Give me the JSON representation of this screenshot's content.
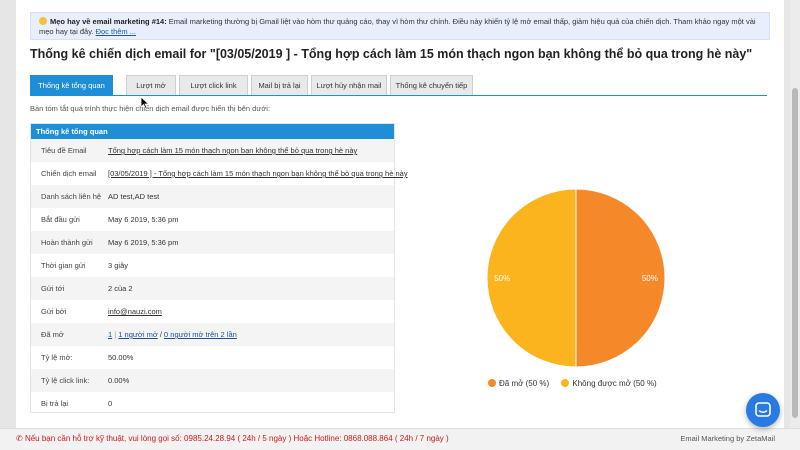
{
  "tip": {
    "label": "Mẹo hay về email marketing #14:",
    "text": " Email marketing thường bị Gmail liệt vào hòm thư quảng cáo, thay vì hòm thư chính. Điều này khiến tỷ lệ mở email thấp, giảm hiệu quả của chiến dịch. Tham khảo ngay một vài mẹo hay tại đây. ",
    "link": "Đọc thêm ..."
  },
  "page_title": "Thống kê chiến dịch email for \"[03/05/2019 ] - Tổng hợp cách làm 15 món thạch ngon bạn không thể bỏ qua trong hè này\"",
  "tabs": [
    {
      "label": "Thống kê tổng quan"
    },
    {
      "label": "Lượt mở"
    },
    {
      "label": "Lượt click link"
    },
    {
      "label": "Mail bị trả lại"
    },
    {
      "label": "Lượt hủy nhận mail"
    },
    {
      "label": "Thống kê chuyển tiếp"
    }
  ],
  "description": "Bản tóm tắt quá trình thực hiện chiến dịch email được hiển thị bên dưới:",
  "panel": {
    "title": "Thống kê tổng quan",
    "rows": [
      {
        "key": "Tiêu đề Email",
        "value": "Tổng hợp cách làm 15 món thạch ngon bạn không thể bỏ qua trong hè này"
      },
      {
        "key": "Chiến dịch email",
        "value": "[03/05/2019 ] - Tổng hợp cách làm 15 món thạch ngon bạn không thể bỏ qua trong hè này"
      },
      {
        "key": "Danh sách liên hệ",
        "value": "AD test,AD test"
      },
      {
        "key": "Bắt đầu gửi",
        "value": "May 6 2019, 5:36 pm"
      },
      {
        "key": "Hoàn thành gửi",
        "value": "May 6 2019, 5:36 pm"
      },
      {
        "key": "Thời gian gửi",
        "value": "3 giây"
      },
      {
        "key": "Gửi tới",
        "value": "2 của 2"
      },
      {
        "key": "Gửi bởi",
        "value": "info@nauzi.com"
      },
      {
        "key": "Đã mở",
        "value": "1"
      },
      {
        "key": "Tỷ lệ mở:",
        "value": "50.00%"
      },
      {
        "key": "Tỷ lệ click link:",
        "value": "0.00%"
      },
      {
        "key": "Bị trả lại",
        "value": "0"
      }
    ],
    "opened_parts": {
      "total": "1",
      "sep1": " | ",
      "people": "1 người mở",
      "sep2": " / ",
      "multi": "0 người mở trên 2 lần"
    }
  },
  "chart_data": {
    "type": "pie",
    "series": [
      {
        "name": "Đã mở (50 %)",
        "value": 50,
        "label": "50%",
        "color": "#f5892a"
      },
      {
        "name": "Không được mở (50 %)",
        "value": 50,
        "label": "50%",
        "color": "#fbb41e"
      }
    ],
    "legend": "bottom"
  },
  "footer": {
    "hotline": "Nếu bạn cần hỗ trợ kỹ thuật, vui lòng gọi số: 0985.24.28.94 ( 24h / 5 ngày ) Hoặc Hotline: 0868.088.864 ( 24h / 7 ngày )",
    "brand": "Email Marketing by ZetaMail"
  }
}
